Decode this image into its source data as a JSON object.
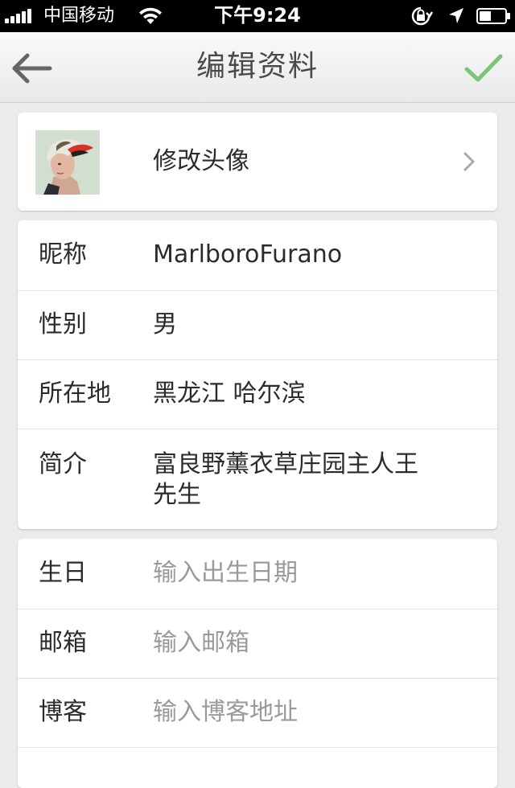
{
  "status_bar": {
    "carrier": "中国移动",
    "time": "下午9:24"
  },
  "nav": {
    "title": "编辑资料"
  },
  "avatar_row": {
    "label": "修改头像"
  },
  "profile_fields": [
    {
      "label": "昵称",
      "value": "MarlboroFurano"
    },
    {
      "label": "性别",
      "value": "男"
    },
    {
      "label": "所在地",
      "value": "黑龙江 哈尔滨"
    },
    {
      "label": "简介",
      "value_line1": "富良野薰衣草庄园主人王",
      "value_line2": "先生"
    }
  ],
  "extra_fields": [
    {
      "label": "生日",
      "placeholder": "输入出生日期"
    },
    {
      "label": "邮箱",
      "placeholder": "输入邮箱"
    },
    {
      "label": "博客",
      "placeholder": "输入博客地址"
    }
  ],
  "colors": {
    "accent_check": "#7cc576",
    "background": "#ebebeb",
    "placeholder": "#9a9a9a"
  }
}
